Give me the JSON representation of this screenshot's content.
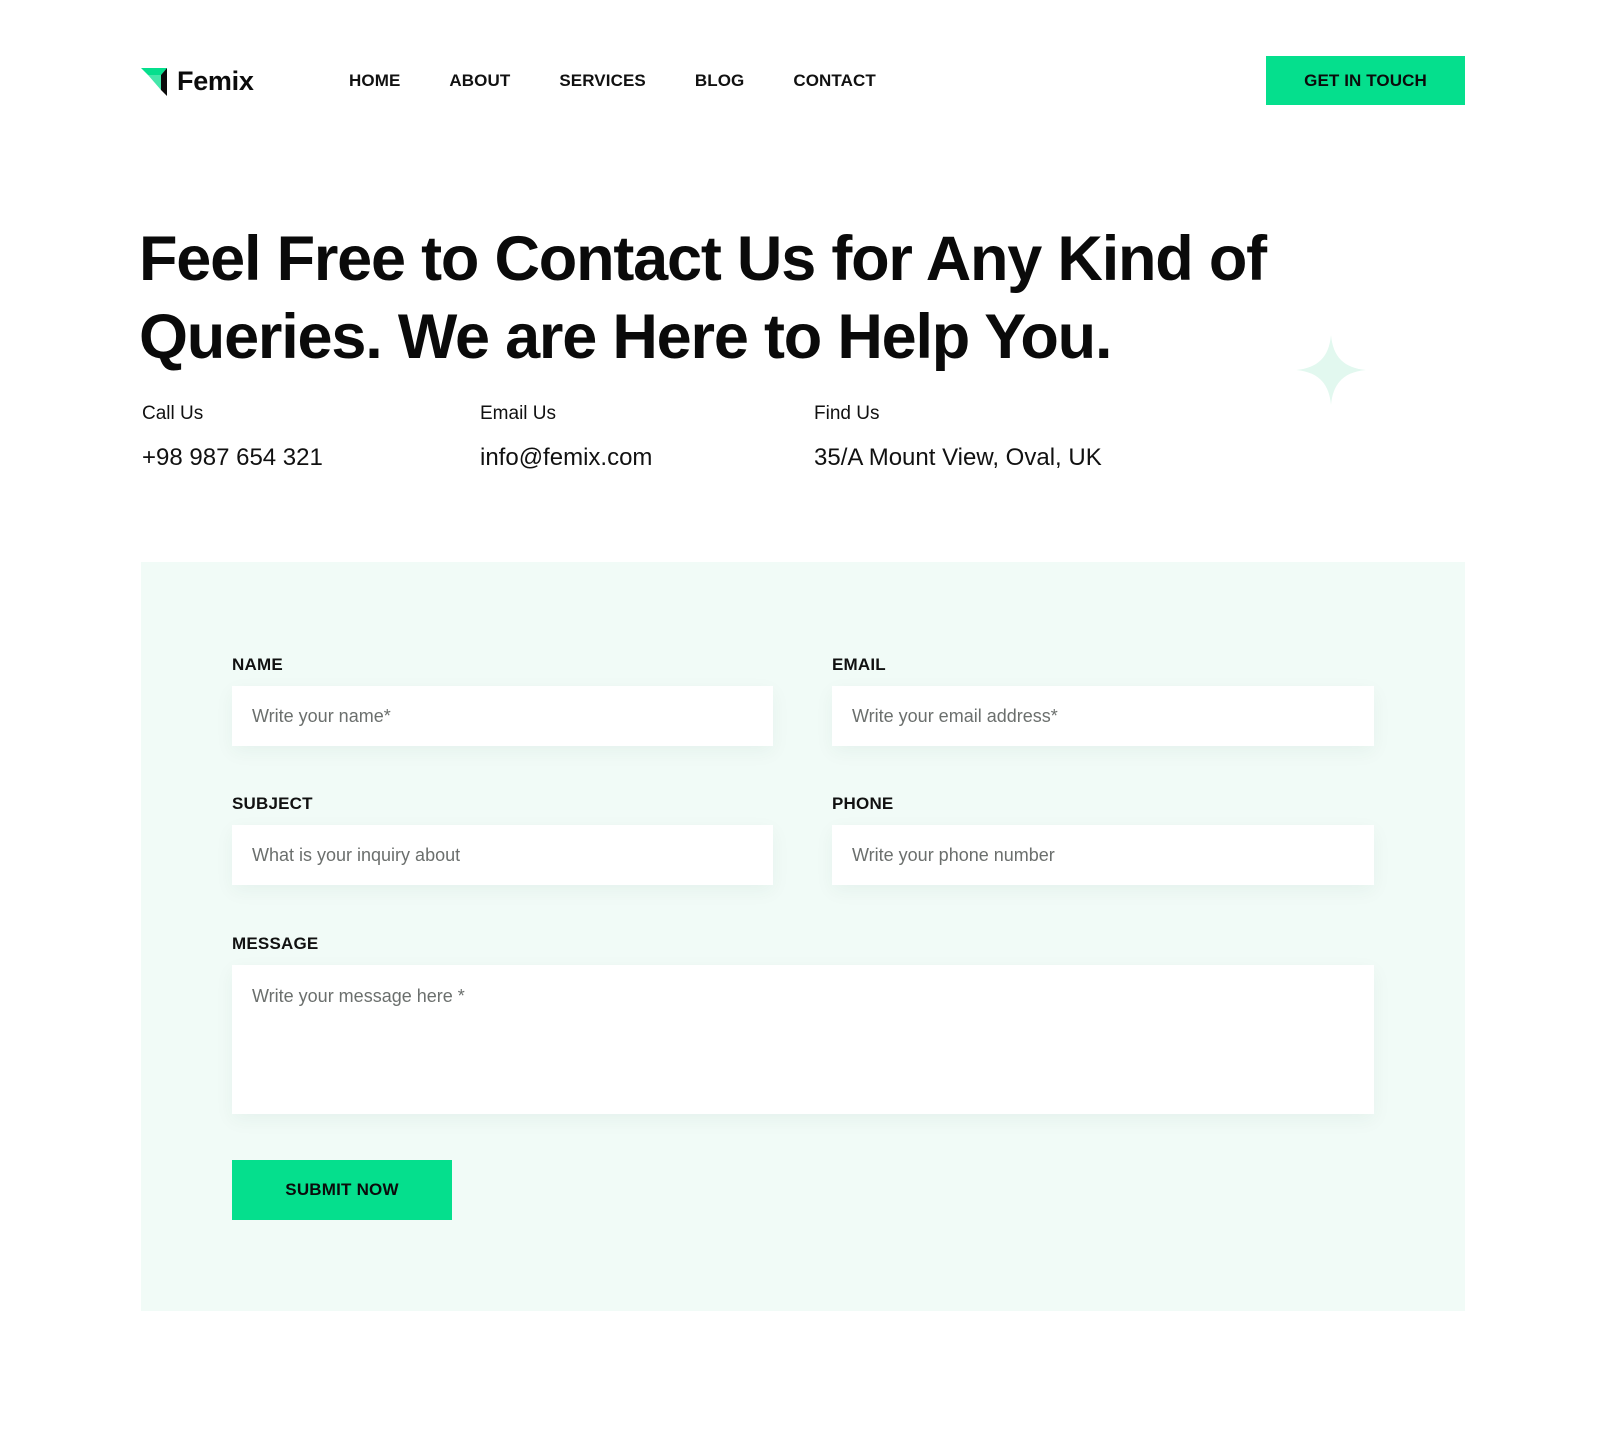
{
  "brand": {
    "name": "Femix",
    "color": "#05df8d"
  },
  "nav": {
    "items": [
      {
        "label": "HOME"
      },
      {
        "label": "ABOUT"
      },
      {
        "label": "SERVICES"
      },
      {
        "label": "BLOG"
      },
      {
        "label": "CONTACT"
      }
    ],
    "cta_label": "GET IN TOUCH"
  },
  "hero": {
    "title": "Feel Free to Contact Us for Any Kind of Queries. We are Here to Help You.",
    "decoration_icon": "sparkle-icon"
  },
  "contact_info": {
    "call": {
      "label": "Call Us",
      "value": "+98  987 654 321"
    },
    "email": {
      "label": "Email Us",
      "value": "info@femix.com"
    },
    "find": {
      "label": "Find Us",
      "value": "35/A Mount View, Oval, UK"
    }
  },
  "form": {
    "name": {
      "label": "NAME",
      "placeholder": "Write your name*",
      "value": ""
    },
    "email": {
      "label": "EMAIL",
      "placeholder": "Write your email address*",
      "value": ""
    },
    "subject": {
      "label": "SUBJECT",
      "placeholder": "What is your inquiry about",
      "value": ""
    },
    "phone": {
      "label": "PHONE",
      "placeholder": "Write your phone number",
      "value": ""
    },
    "message": {
      "label": "MESSAGE",
      "placeholder": "Write your message here *",
      "value": ""
    },
    "submit_label": "SUBMIT NOW",
    "panel_color": "#f1fbf7"
  }
}
